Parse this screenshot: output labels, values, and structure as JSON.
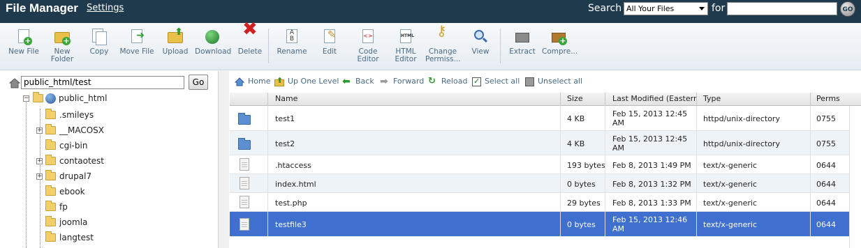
{
  "header": {
    "title": "File Manager",
    "settings_label": "Settings",
    "search_label": "Search",
    "search_scope": "All Your Files",
    "for_label": "for",
    "search_value": "",
    "go_label": "GO"
  },
  "toolbar": {
    "items": [
      {
        "label": "New File",
        "icon": "new-file-icon"
      },
      {
        "label": "New\nFolder",
        "icon": "new-folder-icon"
      },
      {
        "label": "Copy",
        "icon": "copy-icon"
      },
      {
        "label": "Move File",
        "icon": "move-file-icon"
      },
      {
        "label": "Upload",
        "icon": "upload-icon"
      },
      {
        "label": "Download",
        "icon": "download-icon"
      },
      {
        "label": "Delete",
        "icon": "delete-icon"
      },
      {
        "label": "Rename",
        "icon": "rename-icon"
      },
      {
        "label": "Edit",
        "icon": "edit-icon"
      },
      {
        "label": "Code\nEditor",
        "icon": "code-editor-icon"
      },
      {
        "label": "HTML\nEditor",
        "icon": "html-editor-icon"
      },
      {
        "label": "Change\nPermiss...",
        "icon": "change-permissions-icon"
      },
      {
        "label": "View",
        "icon": "view-icon"
      },
      {
        "label": "Extract",
        "icon": "extract-icon"
      },
      {
        "label": "Compre...",
        "icon": "compress-icon"
      }
    ]
  },
  "path_bar": {
    "path": "public_html/test",
    "go_label": "Go"
  },
  "tree": {
    "root": "public_html",
    "children": [
      ".smileys",
      "__MACOSX",
      "cgi-bin",
      "contaotest",
      "drupal7",
      "ebook",
      "fp",
      "joomla",
      "langtest"
    ]
  },
  "nav": {
    "home": "Home",
    "up": "Up One Level",
    "back": "Back",
    "forward": "Forward",
    "reload": "Reload",
    "select_all": "Select all",
    "unselect_all": "Unselect all"
  },
  "table": {
    "headers": {
      "name": "Name",
      "size": "Size",
      "modified": "Last Modified (Eastern St",
      "type": "Type",
      "perms": "Perms"
    },
    "rows": [
      {
        "name": "test1",
        "size": "4 KB",
        "modified": "Feb 15, 2013 12:45 AM",
        "type": "httpd/unix-directory",
        "perms": "0755",
        "kind": "folder"
      },
      {
        "name": "test2",
        "size": "4 KB",
        "modified": "Feb 15, 2013 12:45 AM",
        "type": "httpd/unix-directory",
        "perms": "0755",
        "kind": "folder"
      },
      {
        "name": ".htaccess",
        "size": "193 bytes",
        "modified": "Feb 8, 2013 1:49 PM",
        "type": "text/x-generic",
        "perms": "0644",
        "kind": "file"
      },
      {
        "name": "index.html",
        "size": "0 bytes",
        "modified": "Feb 8, 2013 1:32 PM",
        "type": "text/x-generic",
        "perms": "0644",
        "kind": "file"
      },
      {
        "name": "test.php",
        "size": "29 bytes",
        "modified": "Feb 8, 2013 1:33 PM",
        "type": "text/x-generic",
        "perms": "0644",
        "kind": "file"
      },
      {
        "name": "testfile3",
        "size": "0 bytes",
        "modified": "Feb 15, 2013 12:46 AM",
        "type": "text/x-generic",
        "perms": "0644",
        "kind": "file"
      }
    ]
  },
  "colors": {
    "header_bg": "#1e3a4c",
    "selected_row": "#3f6fcf",
    "alt_row": "#eef3f8",
    "toolbar_text": "#4a6a85"
  }
}
